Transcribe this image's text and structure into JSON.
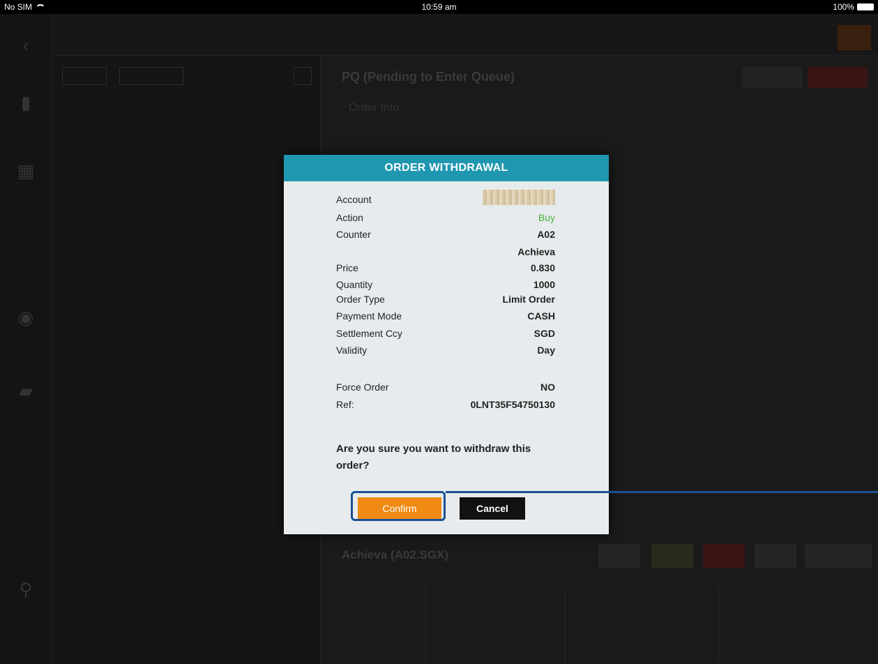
{
  "status_bar": {
    "carrier": "No SIM",
    "time": "10:59 am",
    "battery": "100%"
  },
  "background": {
    "title": "PQ (Pending to Enter Queue)",
    "detail_heading": "Order Info",
    "quote_heading": "Achieva (A02.SGX)"
  },
  "dialog": {
    "title": "ORDER WITHDRAWAL",
    "rows": [
      {
        "label": "Account",
        "value": ""
      },
      {
        "label": "Action",
        "value": "Buy"
      },
      {
        "label": "Counter",
        "value": "A02"
      },
      {
        "label": "",
        "value": "Achieva"
      },
      {
        "label": "Price",
        "value": "0.830"
      },
      {
        "label": "Quantity",
        "value": "1000"
      },
      {
        "label": "Order Type",
        "value": "Limit Order"
      },
      {
        "label": "Payment Mode",
        "value": "CASH"
      },
      {
        "label": "Settlement Ccy",
        "value": "SGD"
      },
      {
        "label": "Validity",
        "value": "Day"
      },
      {
        "label": "Force Order",
        "value": "NO"
      },
      {
        "label": "Ref:",
        "value": "0LNT35F54750130"
      }
    ],
    "question": "Are you sure you want to withdraw this order?",
    "confirm_label": "Confirm",
    "cancel_label": "Cancel"
  },
  "colors": {
    "header": "#1f97b0",
    "confirm": "#f08a14",
    "action_buy": "#4aad3a",
    "annotation": "#1c4f93"
  }
}
